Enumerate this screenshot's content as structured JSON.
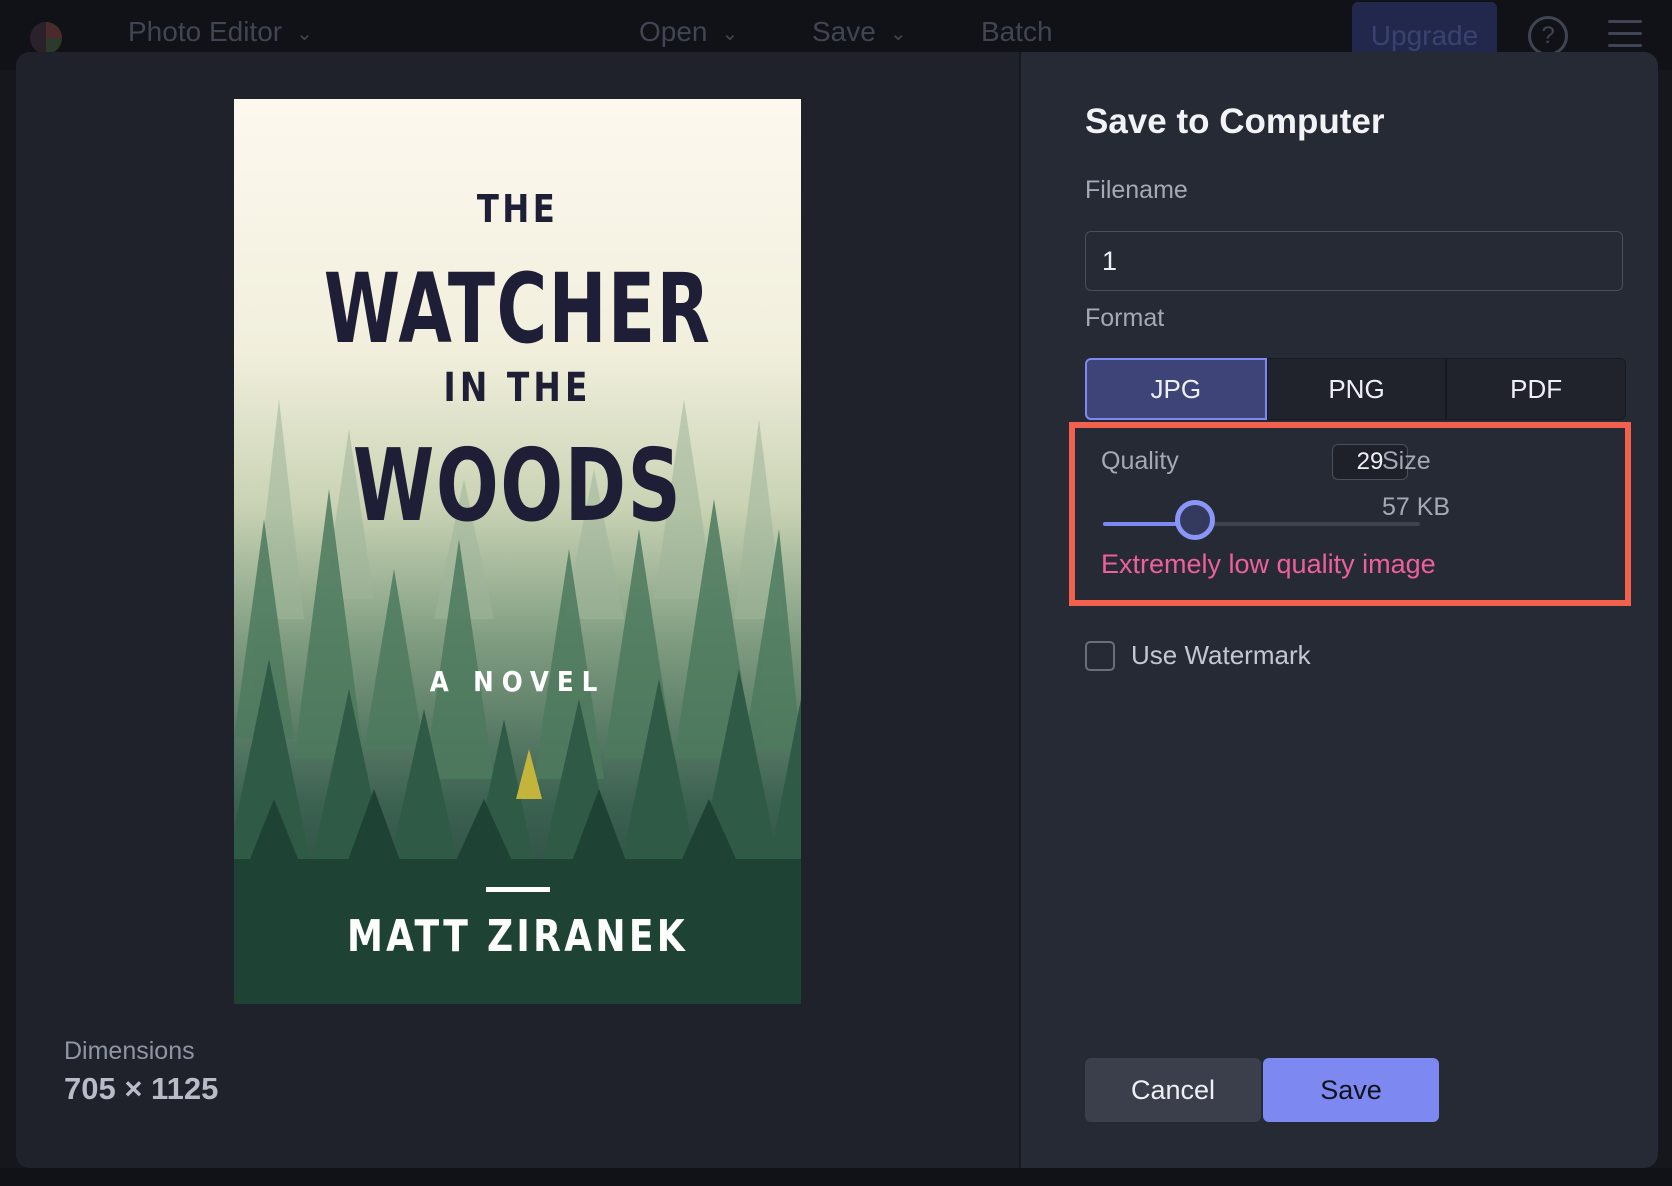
{
  "app": {
    "name": "Photo Editor",
    "menu": [
      "Open",
      "Save",
      "Batch"
    ],
    "upgrade_label": "Upgrade",
    "help_icon": "help-icon",
    "menu_icon": "hamburger-menu-icon"
  },
  "preview": {
    "cover": {
      "line1": "THE",
      "line2": "WATCHER",
      "line3": "IN THE",
      "line4": "WOODS",
      "subtitle": "A NOVEL",
      "author": "MATT ZIRANEK"
    },
    "dimensions_label": "Dimensions",
    "dimensions_value": "705 × 1125"
  },
  "dialog": {
    "title": "Save to Computer",
    "filename_label": "Filename",
    "filename_value": "1",
    "format_label": "Format",
    "formats": [
      "JPG",
      "PNG",
      "PDF"
    ],
    "selected_format": "JPG",
    "quality_label": "Quality",
    "quality_value": "29",
    "quality_percent": 29,
    "size_label": "Size",
    "size_value": "57 KB",
    "warning": "Extremely low quality image",
    "watermark_label": "Use Watermark",
    "watermark_checked": false,
    "cancel_label": "Cancel",
    "save_label": "Save"
  },
  "colors": {
    "accent": "#7d89f0",
    "warning": "#ef5f9d",
    "highlight_box": "#f2604e"
  }
}
